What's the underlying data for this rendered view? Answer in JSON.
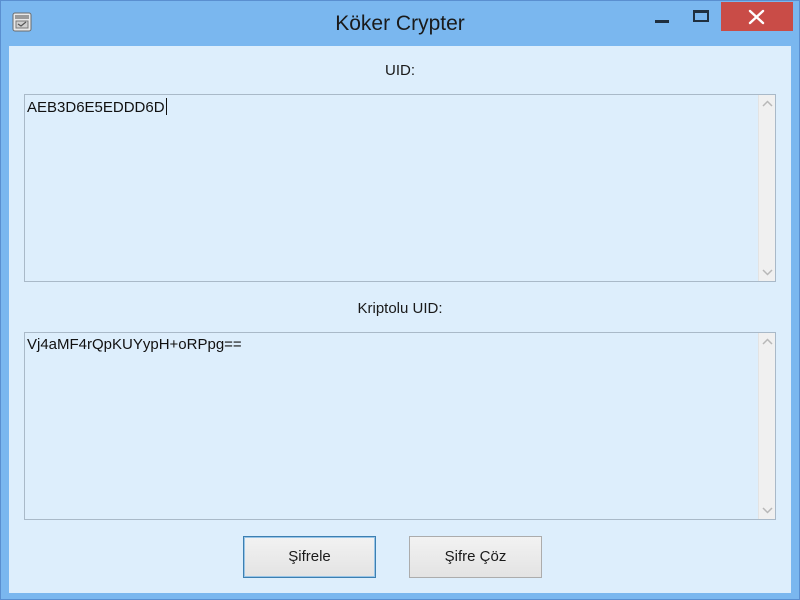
{
  "window": {
    "title": "Köker Crypter"
  },
  "titlebar_buttons": {
    "minimize_icon": "minimize-icon",
    "maximize_icon": "maximize-icon",
    "close_icon": "close-icon"
  },
  "fields": {
    "uid_label": "UID:",
    "uid_value": "AEB3D6E5EDDD6D",
    "encrypted_label": "Kriptolu UID:",
    "encrypted_value": "Vj4aMF4rQpKUYypH+oRPpg=="
  },
  "buttons": {
    "encrypt_label": "Şifrele",
    "decrypt_label": "Şifre Çöz"
  },
  "colors": {
    "title_bar": "#7ab7ef",
    "client_bg": "#ddeefc",
    "close_button": "#c94c47"
  }
}
